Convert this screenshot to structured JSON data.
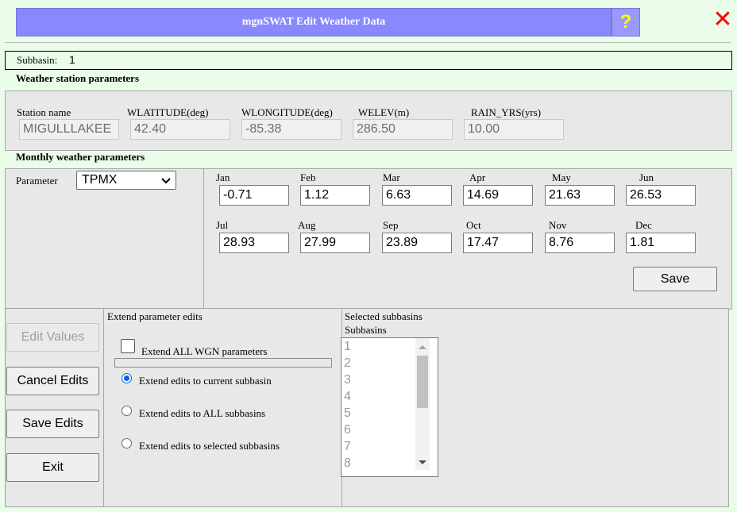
{
  "window": {
    "title": "mgnSWAT Edit Weather Data",
    "help_glyph": "?",
    "close_glyph": "✕"
  },
  "subbasin": {
    "label": "Subbasin:",
    "value": "1"
  },
  "station": {
    "section_title": "Weather station parameters",
    "fields": [
      {
        "label": "Station name",
        "value": "MIGULLLAKEE"
      },
      {
        "label": "WLATITUDE(deg)",
        "value": "42.40"
      },
      {
        "label": "WLONGITUDE(deg)",
        "value": "-85.38"
      },
      {
        "label": "WELEV(m)",
        "value": "286.50"
      },
      {
        "label": "RAIN_YRS(yrs)",
        "value": "10.00"
      }
    ]
  },
  "monthly": {
    "section_title": "Monthly weather parameters",
    "parameter_label": "Parameter",
    "parameter_selected": "TPMX",
    "months": [
      {
        "label": "Jan",
        "value": "-0.71"
      },
      {
        "label": "Feb",
        "value": "1.12"
      },
      {
        "label": "Mar",
        "value": "6.63"
      },
      {
        "label": "Apr",
        "value": "14.69"
      },
      {
        "label": "May",
        "value": "21.63"
      },
      {
        "label": "Jun",
        "value": "26.53"
      },
      {
        "label": "Jul",
        "value": "28.93"
      },
      {
        "label": "Aug",
        "value": "27.99"
      },
      {
        "label": "Sep",
        "value": "23.89"
      },
      {
        "label": "Oct",
        "value": "17.47"
      },
      {
        "label": "Nov",
        "value": "8.76"
      },
      {
        "label": "Dec",
        "value": "1.81"
      }
    ],
    "save_label": "Save"
  },
  "actions": {
    "edit_values": "Edit Values",
    "cancel_edits": "Cancel Edits",
    "save_edits": "Save Edits",
    "exit": "Exit"
  },
  "extend": {
    "title": "Extend parameter edits",
    "all_wgn_label": "Extend ALL WGN parameters",
    "all_wgn_checked": false,
    "options": [
      {
        "label": "Extend edits to current subbasin",
        "selected": true
      },
      {
        "label": "Extend edits to ALL subbasins",
        "selected": false
      },
      {
        "label": "Extend edits to selected subbasins",
        "selected": false
      }
    ]
  },
  "selected_subbasins": {
    "title": "Selected subbasins",
    "list_header": "Subbasins",
    "items": [
      "1",
      "2",
      "3",
      "4",
      "5",
      "6",
      "7",
      "8"
    ]
  }
}
